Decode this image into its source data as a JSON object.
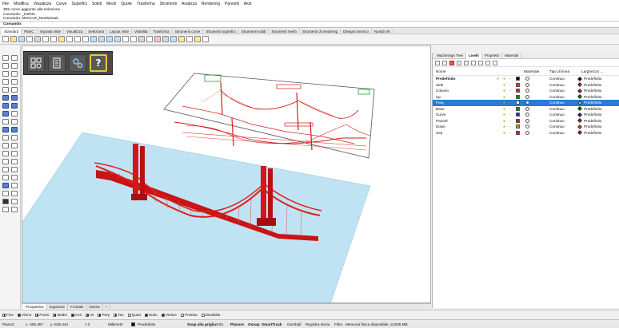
{
  "menu": [
    "File",
    "Modifica",
    "Visualizza",
    "Curve",
    "Superfici",
    "Solidi",
    "Mesh",
    "Quote",
    "Trasforma",
    "Strumenti",
    "Analizza",
    "Rendering",
    "Pannelli",
    "Aiuti"
  ],
  "history": [
    "355 curve aggiunte alla selezione.",
    "Comando: _Delete",
    "Comando: MOSAIX_NewMosaic"
  ],
  "command": {
    "label": "Comando:"
  },
  "toolbar_tabs": [
    "Standard",
    "PlanC",
    "Imposta viste",
    "Visualizza",
    "Seleziona",
    "Layout viste",
    "Visibilità",
    "Trasforma",
    "Strumenti curve",
    "Strumenti superfici",
    "Strumenti solidi",
    "Strumenti mesh",
    "Strumenti di rendering",
    "Disegno tecnico",
    "Novità V6"
  ],
  "viewport_tabs": [
    "Prospettica",
    "Superiore",
    "Frontale",
    "Destra",
    "+"
  ],
  "overlay_icons": [
    "mosaic-tiles-icon",
    "document-icon",
    "gears-icon",
    "help-question-icon"
  ],
  "panel": {
    "tabs": [
      "Machinings Tree",
      "Livelli",
      "Proprietà",
      "Materiali"
    ],
    "columns": {
      "name": "Nome",
      "material": "Materiale",
      "linetype": "Tipo di linea",
      "width": "Larghezza ..."
    },
    "layers": [
      {
        "name": "Predefinito",
        "bold": true,
        "color": "#000000",
        "linetype": "Continuo",
        "width": "Predefinito",
        "check": "✓",
        "selected": false
      },
      {
        "name": "Side",
        "bold": false,
        "color": "#e53030",
        "linetype": "Continuo",
        "width": "Predefinito",
        "check": "",
        "selected": false
      },
      {
        "name": "Column",
        "bold": false,
        "color": "#d32020",
        "linetype": "Continuo",
        "width": "Predefinito",
        "check": "",
        "selected": false
      },
      {
        "name": "Up",
        "bold": false,
        "color": "#118811",
        "linetype": "Continuo",
        "width": "Predefinito",
        "check": "",
        "selected": false
      },
      {
        "name": "Freq",
        "bold": false,
        "color": "#ffffff",
        "linetype": "Continuo",
        "width": "Predefinito",
        "check": "",
        "selected": true
      },
      {
        "name": "Base",
        "bold": false,
        "color": "#118811",
        "linetype": "Continuo",
        "width": "Predefinito",
        "check": "",
        "selected": false
      },
      {
        "name": "Curve",
        "bold": false,
        "color": "#1a2fd1",
        "linetype": "Continuo",
        "width": "Predefinito",
        "check": "",
        "selected": false
      },
      {
        "name": "Pannel",
        "bold": false,
        "color": "#c01818",
        "linetype": "Continuo",
        "width": "Predefinito",
        "check": "",
        "selected": false
      },
      {
        "name": "Down",
        "bold": false,
        "color": "#e8801a",
        "linetype": "Continuo",
        "width": "Predefinito",
        "check": "",
        "selected": false
      },
      {
        "name": "Sea",
        "bold": false,
        "color": "#e02020",
        "linetype": "Continuo",
        "width": "Predefinito",
        "check": "",
        "selected": false
      }
    ]
  },
  "osnaps": [
    {
      "label": "Fine",
      "on": true
    },
    {
      "label": "Vicino",
      "on": true
    },
    {
      "label": "Punto",
      "on": true
    },
    {
      "label": "Medio",
      "on": true
    },
    {
      "label": "Cen",
      "on": true
    },
    {
      "label": "Int",
      "on": true
    },
    {
      "label": "Perp",
      "on": true
    },
    {
      "label": "Tan",
      "on": true
    },
    {
      "label": "Quad",
      "on": false
    },
    {
      "label": "Nodo",
      "on": true
    },
    {
      "label": "Vertice",
      "on": true
    },
    {
      "label": "Proietta",
      "on": false
    },
    {
      "label": "Disabilita",
      "on": false
    }
  ],
  "status": {
    "cplane": "PianoC",
    "x": "x -406.367",
    "y": "y -628.444",
    "z": "z 0",
    "units": "Millimetri",
    "layer": "Predefinito",
    "grid_snap": "Snap alla griglia",
    "ortho": "Orto",
    "planar": "Planare",
    "osnap": "Osnap",
    "smarttrack": "SmartTrack",
    "gumball": "Gumball",
    "history": "Registra storia",
    "filter": "Filtro",
    "memory": "Memoria fisica disponibile: 21835 MB"
  },
  "colors": {
    "bridge": "#e21b1b",
    "plane": "#bfe3f3",
    "selection": "#2a7bd4"
  }
}
